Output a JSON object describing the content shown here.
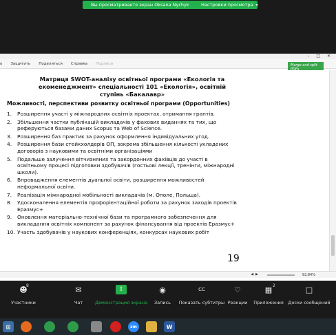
{
  "banner": {
    "sharing_message": "Вы просматриваете экран Oksana Nychyk",
    "view_options": "Настройки просмотра"
  },
  "viewer": {
    "menu": [
      "о",
      "Защитить",
      "Поделиться",
      "Справка",
      "Подписи"
    ],
    "promo": "Merge and split PDFs",
    "status_zoom": "92,84%"
  },
  "document": {
    "title": "Матриця SWOT-аналізу освітньої програми «Екологія та екоменеджмент» спеціальності 101 «Екологія», освітній ступінь «Бакалавр»",
    "subtitle": "Можливості, перспективи розвитку освітньої програми (Opportunities)",
    "items": [
      {
        "n": "1.",
        "text": "Розширення участі у міжнародних освітніх проектах, отримання грантів."
      },
      {
        "n": "2.",
        "text": "Збільшення частки публікацій викладачів у фахових виданнях та тих,  що реферуються базами даних Scopus та Web of Science."
      },
      {
        "n": "3.",
        "text": "Розширення баз практик за рахунок оформлення індивідуальних угод."
      },
      {
        "n": "4.",
        "text": "Розширення бази стейкхолдерів ОП, зокрема збільшення кількості укладених договорів з науковими та освітніми організаціями"
      },
      {
        "n": "5.",
        "text": "Подальше залучення вітчизняних та закордонних фахівців до участі  в освітньому процесі підготовки здобувачів (гостьові лекції, тренінги, міжнародні школи)."
      },
      {
        "n": "6.",
        "text": "Впровадження елементів дуальної освіти, розширення можливостей неформальної освіти."
      },
      {
        "n": "7.",
        "text": "Реалізація міжнародної мобільності викладачів (м. Ополе, Польща)."
      },
      {
        "n": "8.",
        "text": "Удосконалення елементів профорієнтаційної роботи за рахунок заходів проектів Еразмус+"
      },
      {
        "n": "9.",
        "text": "Оновлення  матеріально-технічної бази та програмного забезпечення для викладання освітніх компонент за рахунок фінансування від проектів Еразмус+"
      },
      {
        "n": "10.",
        "text": "Участь здобувачів у наукових конференціях, конкурсах наукових робіт"
      }
    ],
    "slide_number": "19"
  },
  "zoom_bar": {
    "participants_label": "Участники",
    "participants_count": "8",
    "chat_label": "Чат",
    "share_label": "Демонстрация экрана",
    "record_label": "Запись",
    "captions_label": "Показать субтитры",
    "reactions_label": "Реакции",
    "apps_label": "Приложения",
    "whiteboard_label": "Доски сообщений",
    "apps_count": "2"
  },
  "colors": {
    "zoom_green": "#23b14d",
    "taskbar": "#202a2f"
  }
}
